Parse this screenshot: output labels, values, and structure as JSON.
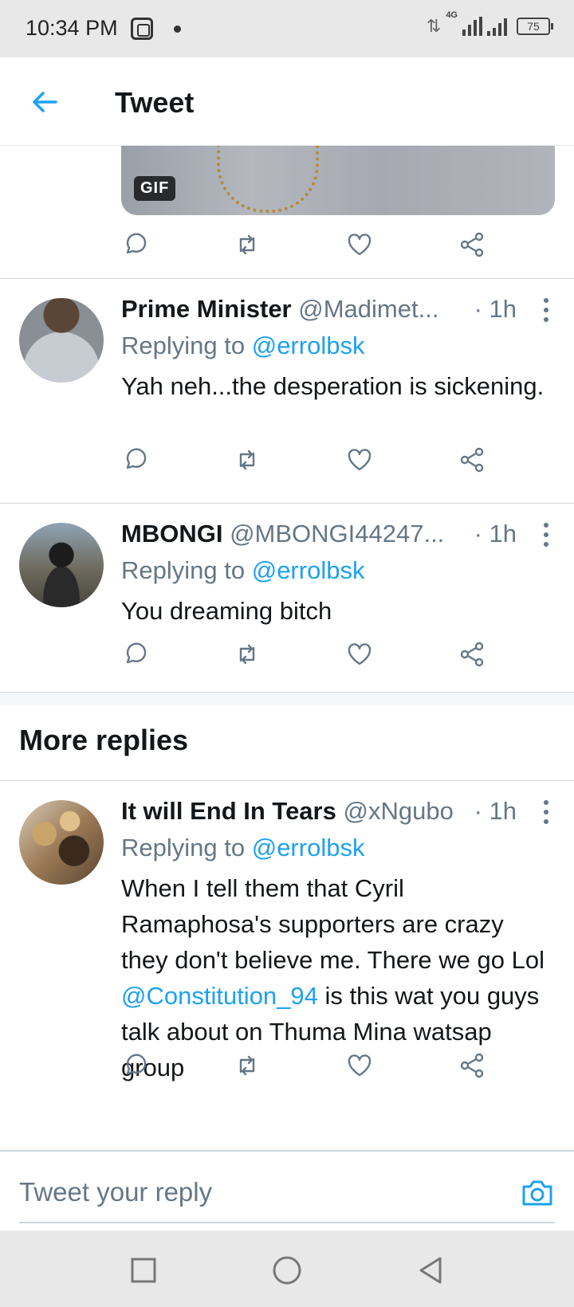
{
  "status_bar": {
    "time": "10:34 PM",
    "network": "4G",
    "battery": "75",
    "icons": [
      "app-notification-icon",
      "dot-icon",
      "data-arrows-icon",
      "signal-icon",
      "battery-icon"
    ]
  },
  "header": {
    "title": "Tweet",
    "back_icon": "arrow-left-icon"
  },
  "gif": {
    "badge": "GIF"
  },
  "tweets": [
    {
      "name": "Prime Minister",
      "handle": "@Madimet...",
      "time": "· 1h",
      "replying_prefix": "Replying to ",
      "replying_to": "@errolbsk",
      "text": "Yah neh...the desperation is sickening."
    },
    {
      "name": "MBONGI",
      "handle": "@MBONGI44247...",
      "time": "· 1h",
      "replying_prefix": "Replying to ",
      "replying_to": "@errolbsk",
      "text": "You dreaming bitch"
    }
  ],
  "more_replies": {
    "heading": "More replies",
    "tweets": [
      {
        "name": "It will End In Tears",
        "handle": "@xNgubo",
        "time": "· 1h",
        "replying_prefix": "Replying to ",
        "replying_to": "@errolbsk",
        "text_before": "When I tell them that Cyril Ramaphosa's supporters are crazy they don't believe me. There we go Lol ",
        "mention": "@Constitution_94",
        "text_after": " is this wat you guys talk about on Thuma Mina watsap group"
      }
    ]
  },
  "reply_bar": {
    "placeholder": "Tweet your reply",
    "camera_icon": "camera-icon"
  },
  "nav_bar": {
    "icons": [
      "recents-square-icon",
      "home-circle-icon",
      "back-triangle-icon"
    ]
  },
  "colors": {
    "accent": "#1da1f2",
    "secondary_text": "#657786",
    "divider": "#d5dadf"
  }
}
